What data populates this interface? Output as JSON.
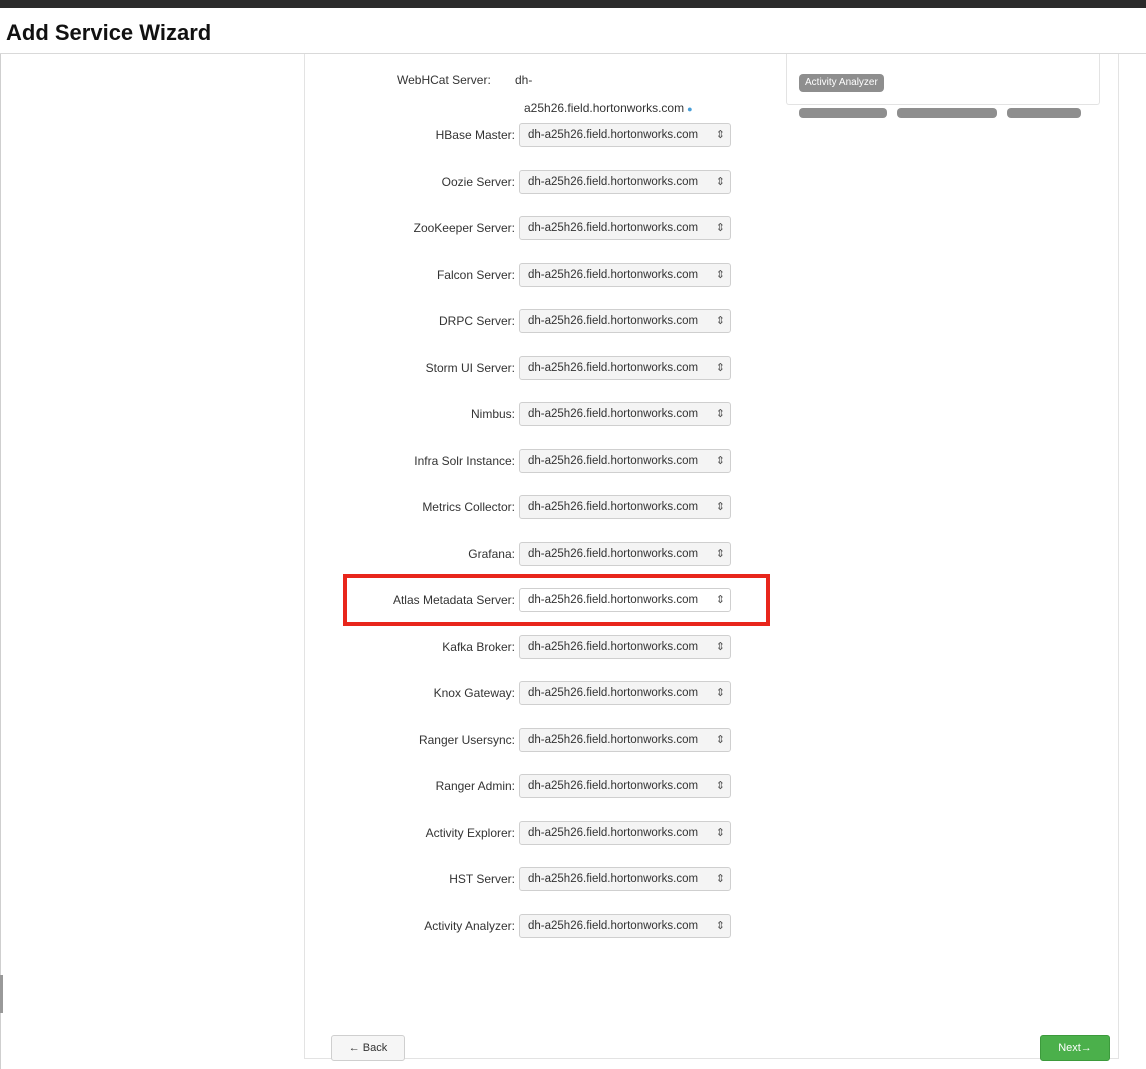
{
  "wizard": {
    "title": "Add Service Wizard"
  },
  "summary_chips": {
    "partial": [
      "",
      "",
      ""
    ],
    "visible": "Activity Analyzer"
  },
  "webhcat": {
    "label": "WebHCat Server:",
    "value_line1": "dh-",
    "value_line2": "a25h26.field.hortonworks.com"
  },
  "assignments": [
    {
      "label": "HBase Master:",
      "value": "dh-a25h26.field.hortonworks.com"
    },
    {
      "label": "Oozie Server:",
      "value": "dh-a25h26.field.hortonworks.com"
    },
    {
      "label": "ZooKeeper Server:",
      "value": "dh-a25h26.field.hortonworks.com"
    },
    {
      "label": "Falcon Server:",
      "value": "dh-a25h26.field.hortonworks.com"
    },
    {
      "label": "DRPC Server:",
      "value": "dh-a25h26.field.hortonworks.com"
    },
    {
      "label": "Storm UI Server:",
      "value": "dh-a25h26.field.hortonworks.com"
    },
    {
      "label": "Nimbus:",
      "value": "dh-a25h26.field.hortonworks.com"
    },
    {
      "label": "Infra Solr Instance:",
      "value": "dh-a25h26.field.hortonworks.com"
    },
    {
      "label": "Metrics Collector:",
      "value": "dh-a25h26.field.hortonworks.com"
    },
    {
      "label": "Grafana:",
      "value": "dh-a25h26.field.hortonworks.com"
    },
    {
      "label": "Atlas Metadata Server:",
      "value": "dh-a25h26.field.hortonworks.com"
    },
    {
      "label": "Kafka Broker:",
      "value": "dh-a25h26.field.hortonworks.com"
    },
    {
      "label": "Knox Gateway:",
      "value": "dh-a25h26.field.hortonworks.com"
    },
    {
      "label": "Ranger Usersync:",
      "value": "dh-a25h26.field.hortonworks.com"
    },
    {
      "label": "Ranger Admin:",
      "value": "dh-a25h26.field.hortonworks.com"
    },
    {
      "label": "Activity Explorer:",
      "value": "dh-a25h26.field.hortonworks.com"
    },
    {
      "label": "HST Server:",
      "value": "dh-a25h26.field.hortonworks.com"
    },
    {
      "label": "Activity Analyzer:",
      "value": "dh-a25h26.field.hortonworks.com"
    }
  ],
  "highlighted_assignment": "Atlas Metadata Server:",
  "buttons": {
    "back": "← Back",
    "next": "Next→"
  },
  "icons": {
    "select_caret": "updown-caret-icon",
    "caret_glyph": "⇕"
  },
  "colors": {
    "highlight": "#e8261c",
    "next_button": "#4bb04b",
    "chip": "#8e8e8e"
  }
}
